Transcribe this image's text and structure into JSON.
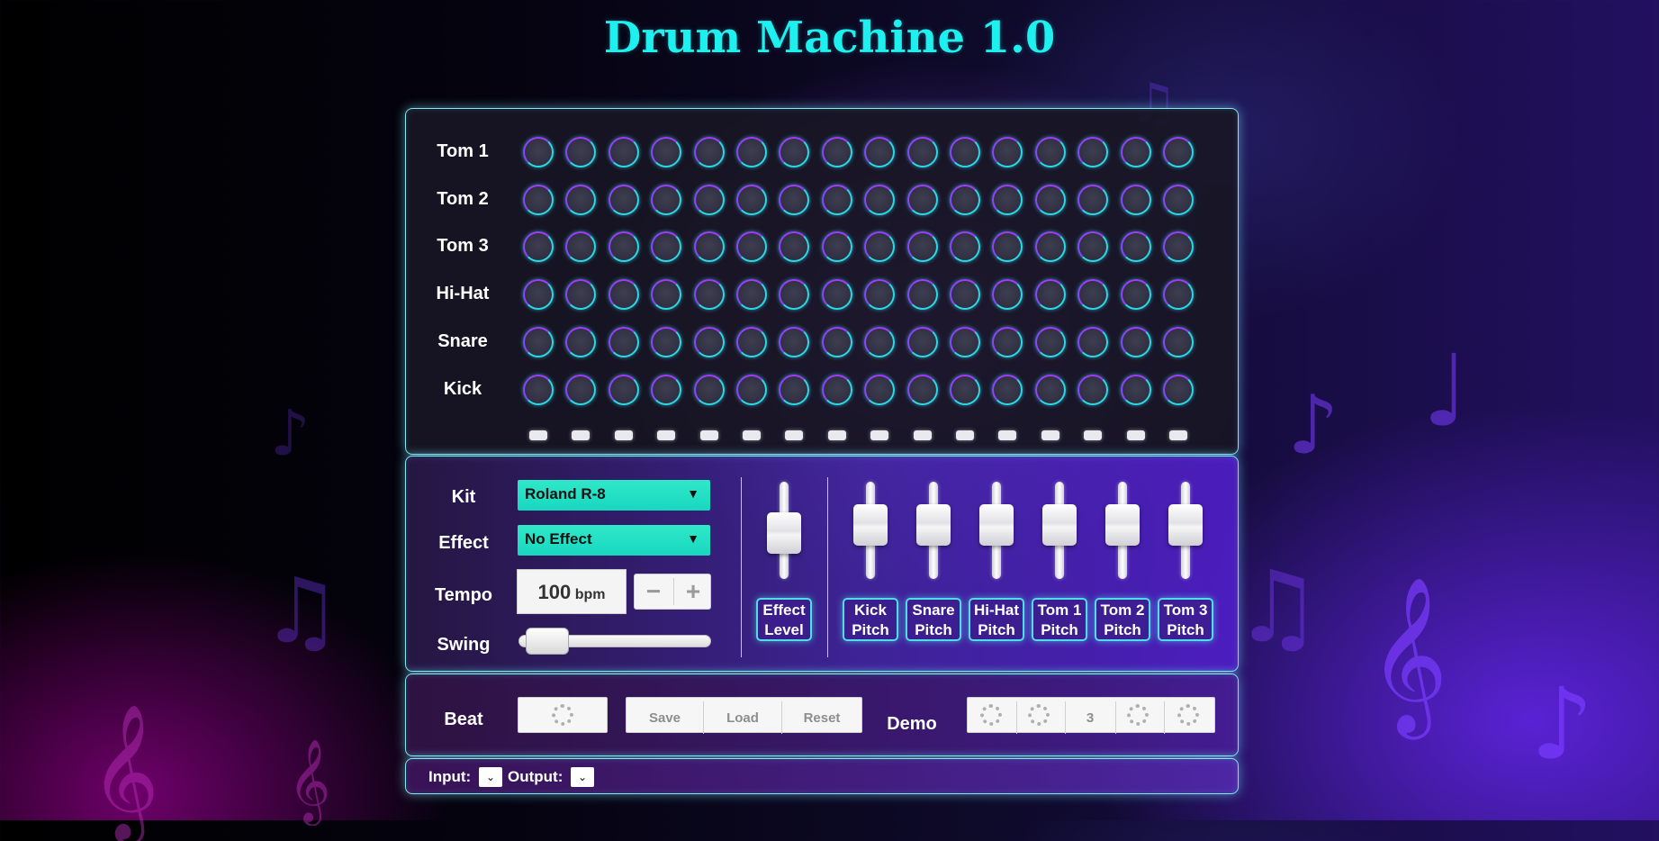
{
  "title": "Drum Machine 1.0",
  "sequencer": {
    "tracks": [
      "Tom 1",
      "Tom 2",
      "Tom 3",
      "Hi-Hat",
      "Snare",
      "Kick"
    ],
    "steps": 16
  },
  "controls": {
    "kit_label": "Kit",
    "kit_value": "Roland R-8",
    "effect_label": "Effect",
    "effect_value": "No Effect",
    "tempo_label": "Tempo",
    "tempo_value": "100",
    "tempo_unit": "bpm",
    "tempo_minus": "−",
    "tempo_plus": "+",
    "swing_label": "Swing",
    "swing_level": 0.05,
    "dropdown_arrow": "▼"
  },
  "faders": [
    {
      "line1": "Effect",
      "line2": "Level",
      "level": 0.45
    },
    {
      "line1": "Kick",
      "line2": "Pitch",
      "level": 0.6
    },
    {
      "line1": "Snare",
      "line2": "Pitch",
      "level": 0.6
    },
    {
      "line1": "Hi-Hat",
      "line2": "Pitch",
      "level": 0.6
    },
    {
      "line1": "Tom 1",
      "line2": "Pitch",
      "level": 0.6
    },
    {
      "line1": "Tom 2",
      "line2": "Pitch",
      "level": 0.6
    },
    {
      "line1": "Tom 3",
      "line2": "Pitch",
      "level": 0.6
    }
  ],
  "beat": {
    "beat_label": "Beat",
    "save": "Save",
    "load": "Load",
    "reset": "Reset",
    "demo_label": "Demo",
    "demo_number": "3"
  },
  "io": {
    "input_label": "Input:",
    "output_label": "Output:",
    "select_arrow": "⌄"
  },
  "colors": {
    "title": "#1ef0f0",
    "pad_ring": "#2ad9e8",
    "select_bg": "#20dcc4"
  }
}
